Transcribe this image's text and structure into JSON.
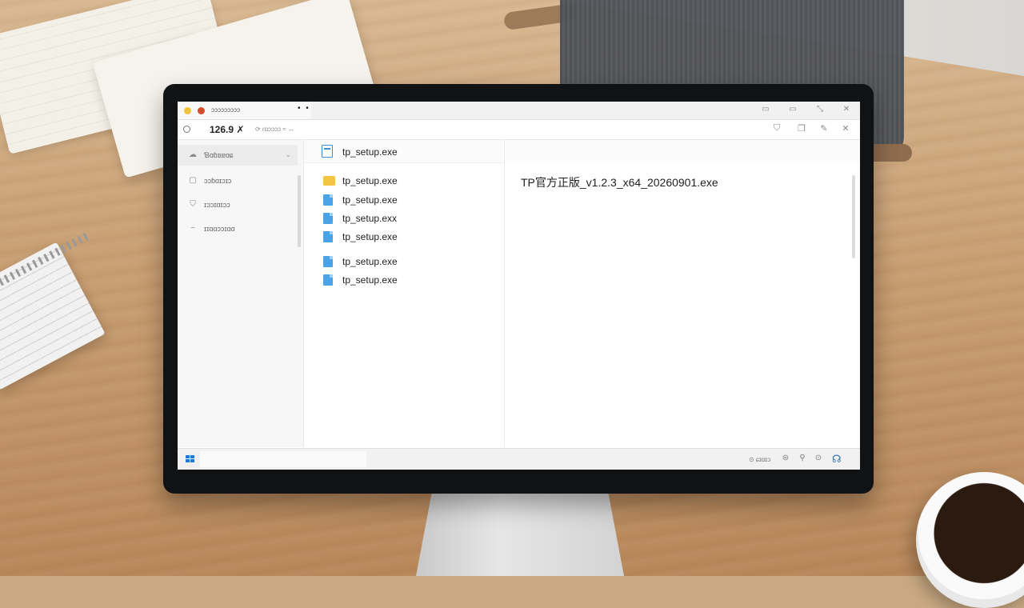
{
  "browser": {
    "tab_title": "ɔɔɔɔɔɔɔɔɔ",
    "tab_menu": "• •",
    "window_buttons": [
      "▭",
      "▭",
      "⤡",
      "✕"
    ]
  },
  "address": {
    "ip": "126.9 ✗",
    "hint": "⟳ ɾɑɔɔɔɔ ≈ ↔"
  },
  "sidebar": {
    "items": [
      {
        "icon": "cloud-icon",
        "glyph": "☁",
        "label": "Ɓɑɓɪɩɐɑɕ",
        "chevron": "⌄"
      },
      {
        "icon": "box-icon",
        "glyph": "▢",
        "label": "ɔɔɓɑɪɔɪɔ"
      },
      {
        "icon": "shield-icon",
        "glyph": "⛉",
        "label": "ɪɔɔɪɑɪɔɔ"
      },
      {
        "icon": "dash-icon",
        "glyph": "~",
        "label": "ɪɪɑɑɔɔɪɑɑ"
      }
    ]
  },
  "files": {
    "header_name": "tp_setup.exe",
    "rows": [
      {
        "name": "tp_setup.exe",
        "type": "folder"
      },
      {
        "name": "tp_setup.exe",
        "type": "blue"
      },
      {
        "name": "tp_setup.exx",
        "type": "blue"
      },
      {
        "name": "tp_setup.exe",
        "type": "blue"
      },
      {
        "name": "tp_setup.exe",
        "type": "blue"
      },
      {
        "name": "tp_setup.exe",
        "type": "blue"
      }
    ]
  },
  "detail": {
    "filename": "TP官方正版_v1.2.3_x64_20260901.exe"
  },
  "status": {
    "text": "⊙ ɕɪɑɪɔ",
    "icons": [
      "⊜",
      "⚲",
      "⊙"
    ],
    "network": "☊"
  }
}
